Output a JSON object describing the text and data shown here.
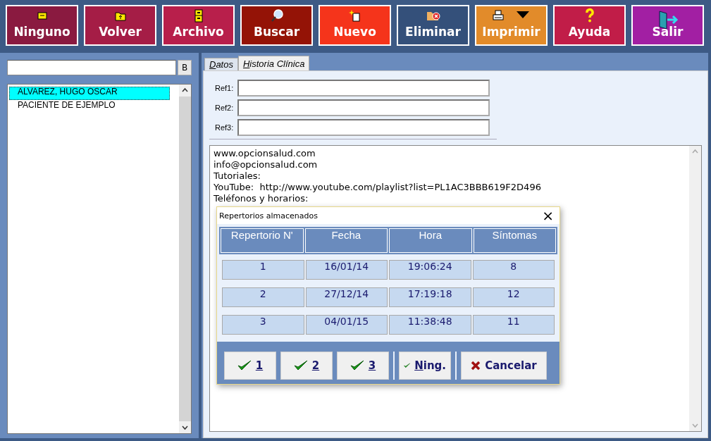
{
  "toolbar": [
    {
      "label": "Ninguno",
      "color": "#8a1a40",
      "kind": "note"
    },
    {
      "label": "Volver",
      "color": "#a51d46",
      "kind": "folder-up"
    },
    {
      "label": "Archivo",
      "color": "#b81f4b",
      "kind": "cabinet"
    },
    {
      "label": "Buscar",
      "color": "#941306",
      "kind": "search"
    },
    {
      "label": "Nuevo",
      "color": "#f5341b",
      "kind": "new"
    },
    {
      "label": "Eliminar",
      "color": "#34507a",
      "kind": "delete"
    },
    {
      "label": "Imprimir",
      "color": "#e28b2a",
      "kind": "print"
    },
    {
      "label": "Ayuda",
      "color": "#c11d48",
      "kind": "help"
    },
    {
      "label": "Salir",
      "color": "#a21fa3",
      "kind": "exit"
    }
  ],
  "sidebar": {
    "search": {
      "button": "B"
    },
    "patients": [
      {
        "name": "ALVAREZ, HUGO OSCAR",
        "selected": true
      },
      {
        "name": "PACIENTE DE EJEMPLO",
        "selected": false
      }
    ]
  },
  "tabs": [
    {
      "label": "Datos",
      "selected": false,
      "underline_first": true
    },
    {
      "label": "Historia Clínica",
      "selected": true,
      "underline_first": true
    }
  ],
  "refs": [
    {
      "label": "Ref1:"
    },
    {
      "label": "Ref2:"
    },
    {
      "label": "Ref3:"
    }
  ],
  "notes": [
    "www.opcionsalud.com",
    "info@opcionsalud.com",
    "Tutoriales:",
    "YouTube:  http://www.youtube.com/playlist?list=PL1AC3BBB619F2D496",
    "Teléfonos y horarios:"
  ],
  "dialog": {
    "title": "Repertorios almacenados",
    "close": "×",
    "columns": [
      "Repertorio N'",
      "Fecha",
      "Hora",
      "Síntomas"
    ],
    "rows": [
      [
        "1",
        "16/01/14",
        "19:06:24",
        "8"
      ],
      [
        "2",
        "27/12/14",
        "17:19:18",
        "12"
      ],
      [
        "3",
        "04/01/15",
        "11:38:48",
        "11"
      ]
    ],
    "buttons": [
      {
        "label": "1",
        "kind": "check",
        "underline_first": true
      },
      {
        "label": "2",
        "kind": "check",
        "underline_first": true
      },
      {
        "label": "3",
        "kind": "check",
        "underline_first": true
      },
      {
        "label": "Ning.",
        "kind": "check",
        "underline_first": true
      },
      {
        "label": "Cancelar",
        "kind": "cancel",
        "underline_first": false
      }
    ]
  }
}
